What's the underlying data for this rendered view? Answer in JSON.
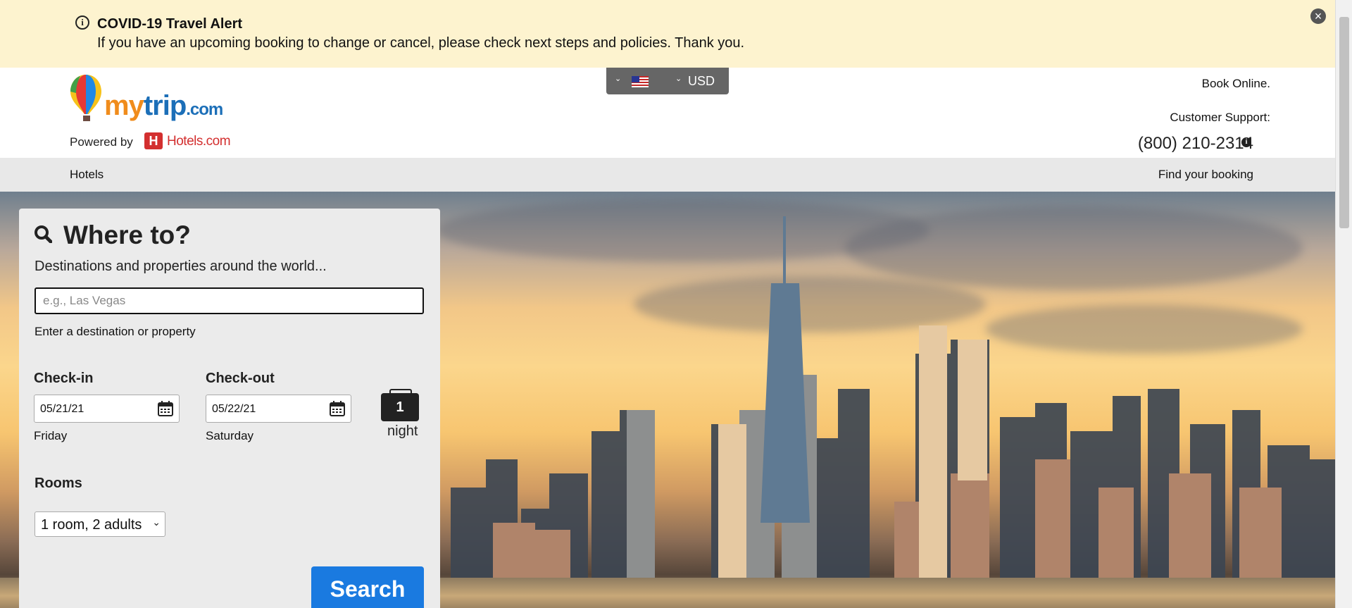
{
  "alert": {
    "icon": "info-circle-icon",
    "title": "COVID-19 Travel Alert",
    "text": "If you have an upcoming booking to change or cancel, please check next steps and policies. Thank you.",
    "close_icon": "close-circle-icon"
  },
  "header": {
    "logo": {
      "my": "my",
      "trip": "trip",
      "com": ".com"
    },
    "powered_by": "Powered by",
    "partner": "Hotels.com",
    "partner_mark": "H",
    "locale": {
      "flag": "us-flag-icon",
      "currency": "USD"
    },
    "book_online": "Book Online.",
    "support_label": "Customer Support:",
    "phone": "(800) 210-2314"
  },
  "nav": {
    "hotels": "Hotels",
    "find_booking": "Find your booking"
  },
  "search": {
    "title": "Where to?",
    "subtitle": "Destinations and properties around the world...",
    "destination_placeholder": "e.g., Las Vegas",
    "destination_hint": "Enter a destination or property",
    "checkin_label": "Check-in",
    "checkin_value": "05/21/21",
    "checkin_day": "Friday",
    "checkout_label": "Check-out",
    "checkout_value": "05/22/21",
    "checkout_day": "Saturday",
    "nights": "1",
    "nights_label": "night",
    "rooms_label": "Rooms",
    "rooms_value": "1 room, 2 adults",
    "button": "Search"
  },
  "colors": {
    "alert_bg": "#fdf3cf",
    "nav_bg": "#e8e8e8",
    "panel_bg": "#ebebeb",
    "primary": "#1a7ae0",
    "brand_orange": "#f08c1c",
    "brand_blue": "#1c6fb8",
    "hotels_red": "#d32f2f"
  }
}
